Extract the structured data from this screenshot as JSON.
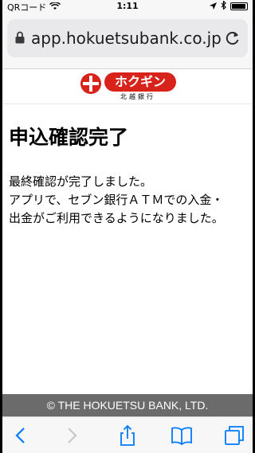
{
  "statusbar": {
    "carrier": "QRコード",
    "time": "1:11"
  },
  "browser": {
    "url": "app.hokuetsubank.co.jp"
  },
  "brand": {
    "logo_text": "ホクギン",
    "logo_subtext": "北越銀行",
    "color": "#d7231a"
  },
  "page": {
    "title": "申込確認完了",
    "message_line1": "最終確認が完了しました。",
    "message_line2": "アプリで、セブン銀行ＡＴＭでの入金・",
    "message_line3": "出金がご利用できるようになりました。"
  },
  "footer": {
    "copyright": "© THE HOKUETSU BANK, LTD."
  },
  "toolbar": {
    "icons": [
      "back-icon",
      "forward-icon",
      "share-icon",
      "bookmarks-icon",
      "tabs-icon"
    ],
    "accent": "#007aff"
  }
}
